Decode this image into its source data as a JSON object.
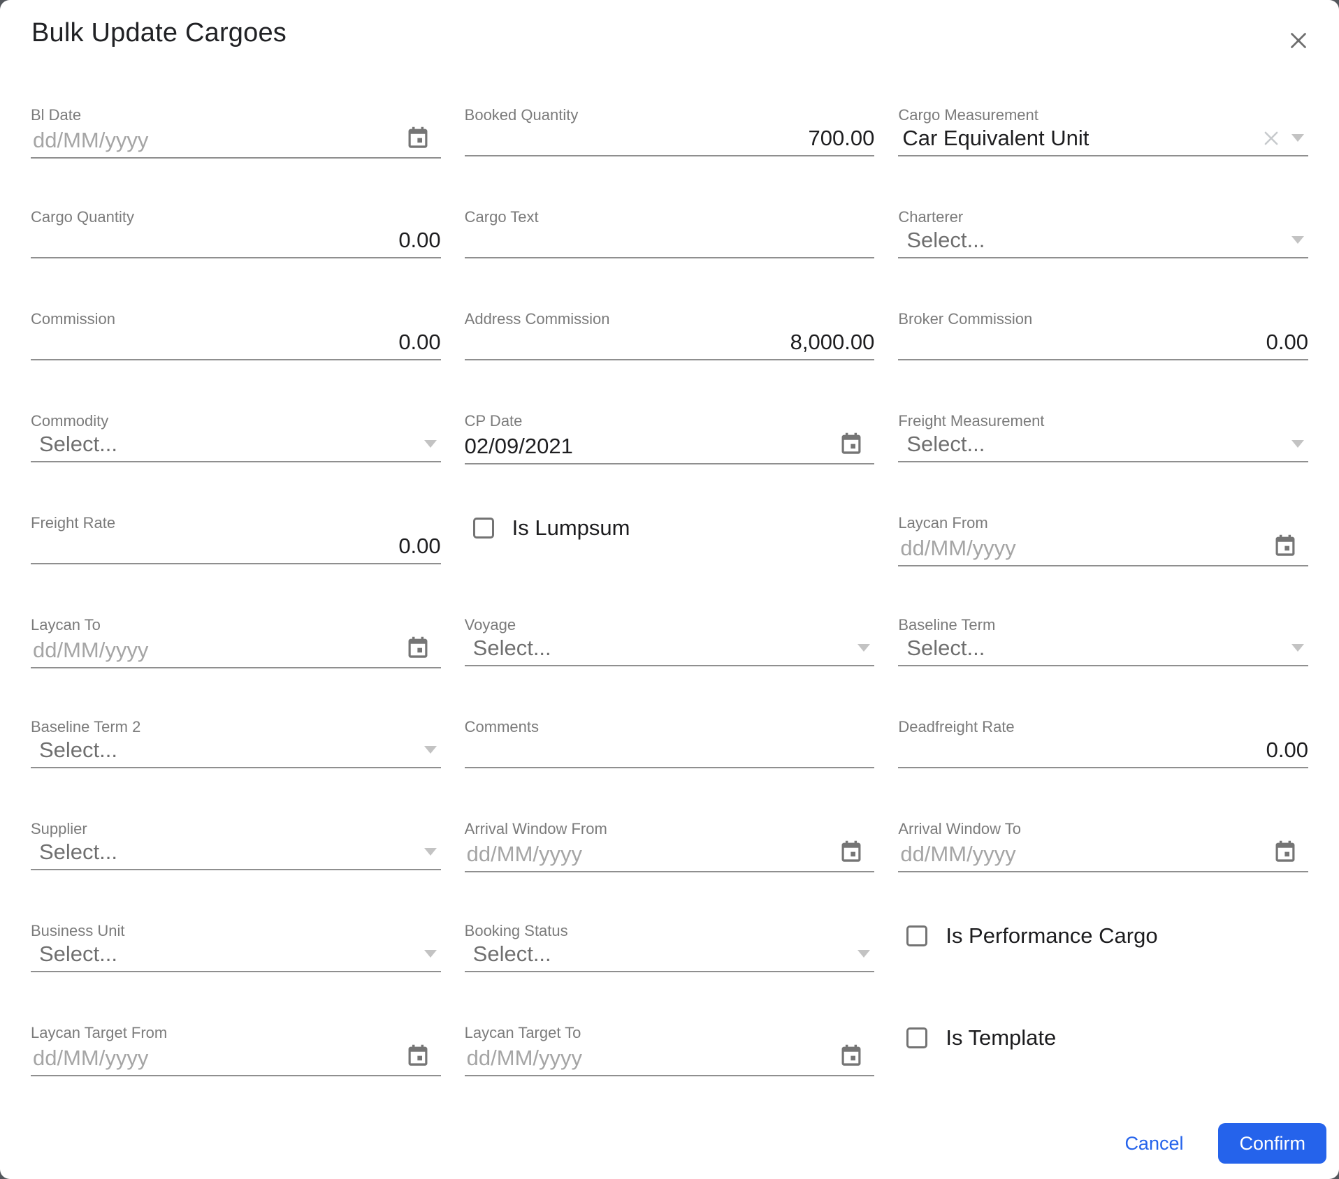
{
  "dialog": {
    "title": "Bulk Update Cargoes"
  },
  "footer": {
    "cancel": "Cancel",
    "confirm": "Confirm"
  },
  "colors": {
    "accent_blue": "#2563eb",
    "label_gray": "#7b7b7b",
    "value_dark": "#1e1e20",
    "date_placeholder_gray": "#a5a5a5",
    "select_placeholder_gray": "#6f6f6f",
    "underline_gray": "#8f8f8f",
    "icon_gray": "#757575"
  },
  "icons": {
    "close": "close-icon",
    "calendar": "calendar-icon",
    "dropdown": "chevron-down-icon",
    "clear": "clear-icon",
    "checkbox": "checkbox-unchecked-icon"
  },
  "fields": [
    {
      "id": "bl-date",
      "type": "date",
      "label": "Bl Date",
      "value": "",
      "placeholder": "dd/MM/yyyy"
    },
    {
      "id": "booked-quantity",
      "type": "number",
      "label": "Booked Quantity",
      "value": "700.00"
    },
    {
      "id": "cargo-measurement",
      "type": "select",
      "label": "Cargo Measurement",
      "value": "Car Equivalent Unit",
      "placeholder": "Select...",
      "clearable": true
    },
    {
      "id": "cargo-quantity",
      "type": "number",
      "label": "Cargo Quantity",
      "value": "0.00"
    },
    {
      "id": "cargo-text",
      "type": "text",
      "label": "Cargo Text",
      "value": ""
    },
    {
      "id": "charterer",
      "type": "select",
      "label": "Charterer",
      "value": "",
      "placeholder": "Select..."
    },
    {
      "id": "commission",
      "type": "number",
      "label": "Commission",
      "value": "0.00"
    },
    {
      "id": "address-commission",
      "type": "number",
      "label": "Address Commission",
      "value": "8,000.00"
    },
    {
      "id": "broker-commission",
      "type": "number",
      "label": "Broker Commission",
      "value": "0.00"
    },
    {
      "id": "commodity",
      "type": "select",
      "label": "Commodity",
      "value": "",
      "placeholder": "Select..."
    },
    {
      "id": "cp-date",
      "type": "date",
      "label": "CP Date",
      "value": "02/09/2021",
      "placeholder": "dd/MM/yyyy"
    },
    {
      "id": "freight-measurement",
      "type": "select",
      "label": "Freight Measurement",
      "value": "",
      "placeholder": "Select..."
    },
    {
      "id": "freight-rate",
      "type": "number",
      "label": "Freight Rate",
      "value": "0.00"
    },
    {
      "id": "is-lumpsum",
      "type": "checkbox",
      "label": "Is Lumpsum",
      "checked": false
    },
    {
      "id": "laycan-from",
      "type": "date",
      "label": "Laycan From",
      "value": "",
      "placeholder": "dd/MM/yyyy"
    },
    {
      "id": "laycan-to",
      "type": "date",
      "label": "Laycan To",
      "value": "",
      "placeholder": "dd/MM/yyyy"
    },
    {
      "id": "voyage",
      "type": "select",
      "label": "Voyage",
      "value": "",
      "placeholder": "Select..."
    },
    {
      "id": "baseline-term",
      "type": "select",
      "label": "Baseline Term",
      "value": "",
      "placeholder": "Select..."
    },
    {
      "id": "baseline-term-2",
      "type": "select",
      "label": "Baseline Term 2",
      "value": "",
      "placeholder": "Select..."
    },
    {
      "id": "comments",
      "type": "text",
      "label": "Comments",
      "value": ""
    },
    {
      "id": "deadfreight-rate",
      "type": "number",
      "label": "Deadfreight Rate",
      "value": "0.00"
    },
    {
      "id": "supplier",
      "type": "select",
      "label": "Supplier",
      "value": "",
      "placeholder": "Select..."
    },
    {
      "id": "arrival-window-from",
      "type": "date",
      "label": "Arrival Window From",
      "value": "",
      "placeholder": "dd/MM/yyyy"
    },
    {
      "id": "arrival-window-to",
      "type": "date",
      "label": "Arrival Window To",
      "value": "",
      "placeholder": "dd/MM/yyyy"
    },
    {
      "id": "business-unit",
      "type": "select",
      "label": "Business Unit",
      "value": "",
      "placeholder": "Select..."
    },
    {
      "id": "booking-status",
      "type": "select",
      "label": "Booking Status",
      "value": "",
      "placeholder": "Select..."
    },
    {
      "id": "is-performance-cargo",
      "type": "checkbox",
      "label": "Is Performance Cargo",
      "checked": false
    },
    {
      "id": "laycan-target-from",
      "type": "date",
      "label": "Laycan Target From",
      "value": "",
      "placeholder": "dd/MM/yyyy"
    },
    {
      "id": "laycan-target-to",
      "type": "date",
      "label": "Laycan Target To",
      "value": "",
      "placeholder": "dd/MM/yyyy"
    },
    {
      "id": "is-template",
      "type": "checkbox",
      "label": "Is Template",
      "checked": false
    }
  ]
}
